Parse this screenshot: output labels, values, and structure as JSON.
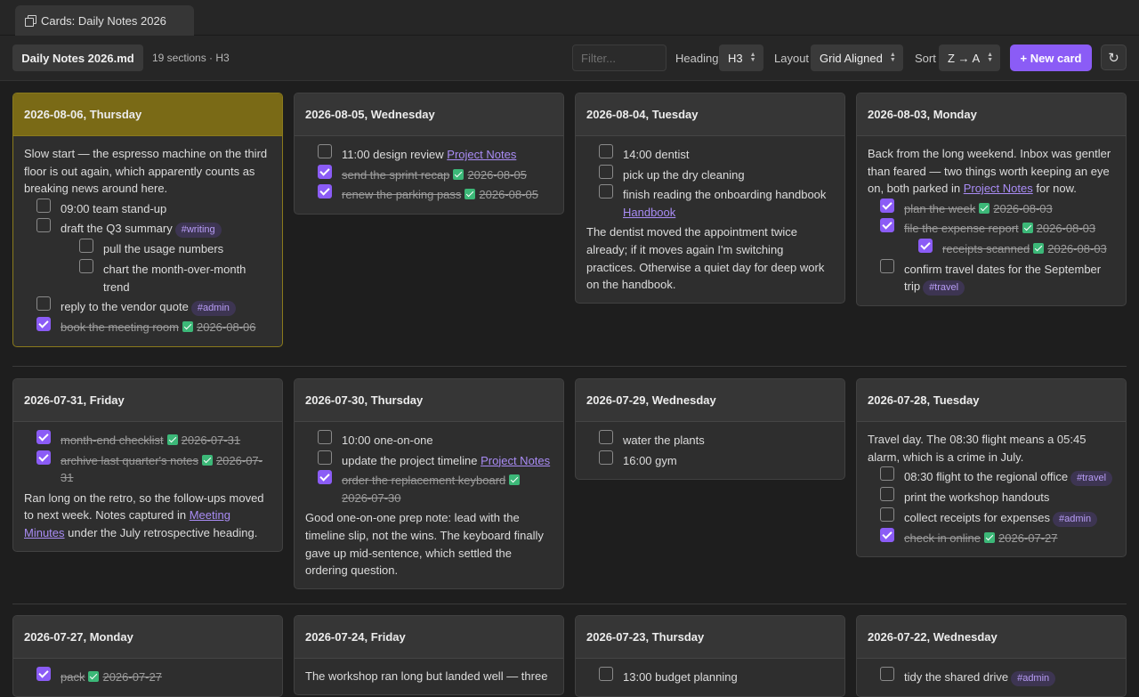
{
  "tab": {
    "title": "Cards: Daily Notes 2026",
    "icon": "cards-icon"
  },
  "toolbar": {
    "file": "Daily Notes 2026.md",
    "meta": "19 sections · H3",
    "filter_placeholder": "Filter...",
    "heading_label": "Heading",
    "heading_value": "H3",
    "layout_label": "Layout",
    "layout_value": "Grid Aligned",
    "sort_label": "Sort",
    "sort_value": "Z → A",
    "new_card": "+ New card",
    "refresh": "↻"
  },
  "colors": {
    "accent": "#8b5cf6",
    "active_header": "#7a6a16",
    "done_check": "#3cb878",
    "tag_bg": "#3d3552"
  },
  "cards": [
    {
      "title": "2026-08-06, Thursday",
      "active": true,
      "items": [
        {
          "t": "p",
          "parts": [
            {
              "text": "Slow start — the espresso machine on the third floor is out again, which apparently counts as breaking news around here."
            }
          ]
        },
        {
          "t": "task",
          "lvl": 1,
          "done": false,
          "parts": [
            {
              "text": "09:00 team stand-up"
            }
          ]
        },
        {
          "t": "task",
          "lvl": 1,
          "done": false,
          "parts": [
            {
              "text": "draft the Q3 summary"
            },
            {
              "tag": "#writing"
            }
          ]
        },
        {
          "t": "task",
          "lvl": 2,
          "done": false,
          "parts": [
            {
              "text": "pull the usage numbers"
            }
          ]
        },
        {
          "t": "task",
          "lvl": 2,
          "done": false,
          "parts": [
            {
              "text": "chart the month-over-month trend"
            }
          ]
        },
        {
          "t": "task",
          "lvl": 1,
          "done": false,
          "parts": [
            {
              "text": "reply to the vendor quote"
            },
            {
              "tag": "#admin"
            }
          ]
        },
        {
          "t": "task",
          "lvl": 1,
          "done": true,
          "parts": [
            {
              "text": "book the meeting room"
            },
            {
              "check": true
            },
            {
              "text": "2026-08-06"
            }
          ]
        }
      ]
    },
    {
      "title": "2026-08-05, Wednesday",
      "items": [
        {
          "t": "task",
          "lvl": 1,
          "done": false,
          "parts": [
            {
              "text": "11:00 design review "
            },
            {
              "link": "Project Notes"
            }
          ]
        },
        {
          "t": "task",
          "lvl": 1,
          "done": true,
          "parts": [
            {
              "text": "send the sprint recap"
            },
            {
              "check": true
            },
            {
              "text": "2026-08-05"
            }
          ]
        },
        {
          "t": "task",
          "lvl": 1,
          "done": true,
          "parts": [
            {
              "text": "renew the parking pass"
            },
            {
              "check": true
            },
            {
              "text": "2026-08-05"
            }
          ]
        }
      ]
    },
    {
      "title": "2026-08-04, Tuesday",
      "items": [
        {
          "t": "task",
          "lvl": 1,
          "done": false,
          "parts": [
            {
              "text": "14:00 dentist"
            }
          ]
        },
        {
          "t": "task",
          "lvl": 1,
          "done": false,
          "parts": [
            {
              "text": "pick up the dry cleaning"
            }
          ]
        },
        {
          "t": "task",
          "lvl": 1,
          "done": false,
          "parts": [
            {
              "text": "finish reading the onboarding handbook "
            },
            {
              "link": "Handbook"
            }
          ]
        },
        {
          "t": "p",
          "parts": [
            {
              "text": "The dentist moved the appointment twice already; if it moves again I'm switching practices. Otherwise a quiet day for deep work on the handbook."
            }
          ]
        }
      ]
    },
    {
      "title": "2026-08-03, Monday",
      "items": [
        {
          "t": "p",
          "parts": [
            {
              "text": "Back from the long weekend. Inbox was gentler than feared — two things worth keeping an eye on, both parked in "
            },
            {
              "link": "Project Notes"
            },
            {
              "text": " for now."
            }
          ]
        },
        {
          "t": "task",
          "lvl": 1,
          "done": true,
          "parts": [
            {
              "text": "plan the week"
            },
            {
              "check": true
            },
            {
              "text": "2026-08-03"
            }
          ]
        },
        {
          "t": "task",
          "lvl": 1,
          "done": true,
          "parts": [
            {
              "text": "file the expense report"
            },
            {
              "check": true
            },
            {
              "text": "2026-08-03"
            }
          ]
        },
        {
          "t": "task",
          "lvl": 3,
          "done": true,
          "parts": [
            {
              "text": "receipts scanned"
            },
            {
              "check": true
            },
            {
              "text": "2026-08-03"
            }
          ]
        },
        {
          "t": "task",
          "lvl": 1,
          "done": false,
          "parts": [
            {
              "text": "confirm travel dates for the September trip"
            },
            {
              "tag": "#travel"
            }
          ]
        }
      ]
    },
    {
      "title": "2026-07-31, Friday",
      "items": [
        {
          "t": "task",
          "lvl": 1,
          "done": true,
          "parts": [
            {
              "text": "month-end checklist"
            },
            {
              "check": true
            },
            {
              "text": "2026-07-31"
            }
          ]
        },
        {
          "t": "task",
          "lvl": 1,
          "done": true,
          "parts": [
            {
              "text": "archive last quarter's notes"
            },
            {
              "check": true
            },
            {
              "text": "2026-07-31"
            }
          ]
        },
        {
          "t": "p",
          "parts": [
            {
              "text": "Ran long on the retro, so the follow-ups moved to next week. Notes captured in "
            },
            {
              "link": "Meeting Minutes"
            },
            {
              "text": " under the July retrospective heading."
            }
          ]
        }
      ]
    },
    {
      "title": "2026-07-30, Thursday",
      "items": [
        {
          "t": "task",
          "lvl": 1,
          "done": false,
          "parts": [
            {
              "text": "10:00 one-on-one"
            }
          ]
        },
        {
          "t": "task",
          "lvl": 1,
          "done": false,
          "parts": [
            {
              "text": "update the project timeline "
            },
            {
              "link": "Project Notes"
            }
          ]
        },
        {
          "t": "task",
          "lvl": 1,
          "done": true,
          "parts": [
            {
              "text": "order the replacement keyboard"
            },
            {
              "check": true
            },
            {
              "text": "2026-07-30"
            }
          ]
        },
        {
          "t": "p",
          "parts": [
            {
              "text": "Good one-on-one prep note: lead with the timeline slip, not the wins. The keyboard finally gave up mid-sentence, which settled the ordering question."
            }
          ]
        }
      ]
    },
    {
      "title": "2026-07-29, Wednesday",
      "items": [
        {
          "t": "task",
          "lvl": 1,
          "done": false,
          "parts": [
            {
              "text": "water the plants"
            }
          ]
        },
        {
          "t": "task",
          "lvl": 1,
          "done": false,
          "parts": [
            {
              "text": "16:00 gym"
            }
          ]
        }
      ]
    },
    {
      "title": "2026-07-28, Tuesday",
      "items": [
        {
          "t": "p",
          "parts": [
            {
              "text": "Travel day. The 08:30 flight means a 05:45 alarm, which is a crime in July."
            }
          ]
        },
        {
          "t": "task",
          "lvl": 1,
          "done": false,
          "parts": [
            {
              "text": "08:30 flight to the regional office"
            },
            {
              "tag": "#travel"
            }
          ]
        },
        {
          "t": "task",
          "lvl": 1,
          "done": false,
          "parts": [
            {
              "text": "print the workshop handouts"
            }
          ]
        },
        {
          "t": "task",
          "lvl": 1,
          "done": false,
          "parts": [
            {
              "text": "collect receipts for expenses"
            },
            {
              "tag": "#admin"
            }
          ]
        },
        {
          "t": "task",
          "lvl": 1,
          "done": true,
          "parts": [
            {
              "text": "check in online"
            },
            {
              "check": true
            },
            {
              "text": "2026-07-27"
            }
          ]
        }
      ]
    },
    {
      "title": "2026-07-27, Monday",
      "items": [
        {
          "t": "task",
          "lvl": 1,
          "done": true,
          "parts": [
            {
              "text": "pack"
            },
            {
              "check": true
            },
            {
              "text": "2026-07-27"
            }
          ]
        }
      ]
    },
    {
      "title": "2026-07-24, Friday",
      "items": [
        {
          "t": "p",
          "parts": [
            {
              "text": "The workshop ran long but landed well — three"
            }
          ]
        }
      ]
    },
    {
      "title": "2026-07-23, Thursday",
      "items": [
        {
          "t": "task",
          "lvl": 1,
          "done": false,
          "parts": [
            {
              "text": "13:00 budget planning"
            }
          ]
        }
      ]
    },
    {
      "title": "2026-07-22, Wednesday",
      "items": [
        {
          "t": "task",
          "lvl": 1,
          "done": false,
          "parts": [
            {
              "text": "tidy the shared drive"
            },
            {
              "tag": "#admin"
            }
          ]
        }
      ]
    }
  ]
}
